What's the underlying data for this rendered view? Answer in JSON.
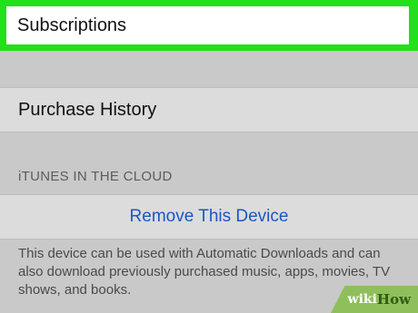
{
  "subscriptions": {
    "label": "Subscriptions"
  },
  "purchase_history": {
    "label": "Purchase History"
  },
  "itunes_cloud": {
    "section_header": "iTUNES IN THE CLOUD",
    "remove_device_label": "Remove This Device",
    "footer_note": "This device can be used with Automatic Downloads and can also download previously purchased music, apps, movies, TV shows, and books."
  },
  "watermark": {
    "wiki": "wiki",
    "how": "How"
  },
  "colors": {
    "highlight": "#22e01a",
    "link": "#1a56c8",
    "background": "#c9c9c9",
    "cell": "#dcdcdc"
  }
}
